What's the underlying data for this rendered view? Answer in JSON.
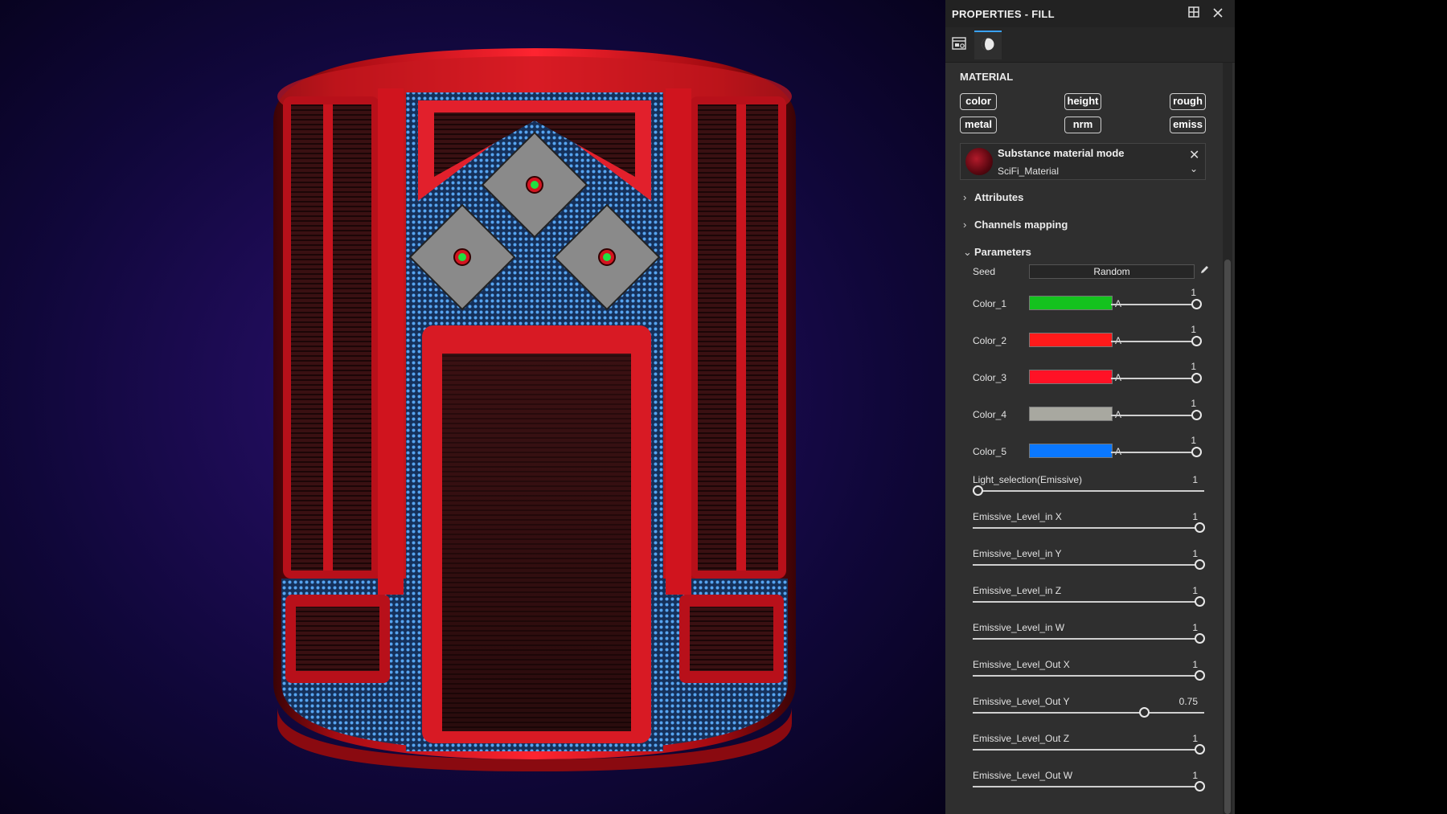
{
  "panel": {
    "title": "PROPERTIES - FILL",
    "dock_icon": "dock-icon",
    "close_icon": "close-icon",
    "tabs": [
      {
        "icon": "layer-settings-icon",
        "active": false
      },
      {
        "icon": "material-sphere-icon",
        "active": true
      }
    ]
  },
  "material": {
    "section_title": "MATERIAL",
    "channels": [
      "color",
      "height",
      "rough",
      "metal",
      "nrm",
      "emiss"
    ]
  },
  "substance": {
    "title": "Substance material mode",
    "material_name": "SciFi_Material",
    "close_glyph": "✕",
    "chevron": "⌄"
  },
  "sections": {
    "attributes": "Attributes",
    "channels_mapping": "Channels mapping",
    "parameters": "Parameters",
    "collapsed_glyph": "›",
    "expanded_glyph": "⌄"
  },
  "seed": {
    "label": "Seed",
    "value": "Random"
  },
  "colors": [
    {
      "label": "Color_1",
      "hex": "#14c21e",
      "alpha_label": "A",
      "value": "1",
      "level": 1
    },
    {
      "label": "Color_2",
      "hex": "#ff1a1a",
      "alpha_label": "A",
      "value": "1",
      "level": 1
    },
    {
      "label": "Color_3",
      "hex": "#ff1226",
      "alpha_label": "A",
      "value": "1",
      "level": 1
    },
    {
      "label": "Color_4",
      "hex": "#a8a8a0",
      "alpha_label": "A",
      "value": "1",
      "level": 1
    },
    {
      "label": "Color_5",
      "hex": "#0a78ff",
      "alpha_label": "A",
      "value": "1",
      "level": 1
    }
  ],
  "sliders": [
    {
      "label": "Light_selection(Emissive)",
      "value": "1",
      "level": 0
    },
    {
      "label": "Emissive_Level_in X",
      "value": "1",
      "level": 1
    },
    {
      "label": "Emissive_Level_in Y",
      "value": "1",
      "level": 1
    },
    {
      "label": "Emissive_Level_in Z",
      "value": "1",
      "level": 1
    },
    {
      "label": "Emissive_Level_in W",
      "value": "1",
      "level": 1
    },
    {
      "label": "Emissive_Level_Out X",
      "value": "1",
      "level": 1
    },
    {
      "label": "Emissive_Level_Out Y",
      "value": "0.75",
      "level": 0.75
    },
    {
      "label": "Emissive_Level_Out Z",
      "value": "1",
      "level": 1
    },
    {
      "label": "Emissive_Level_Out W",
      "value": "1",
      "level": 1
    }
  ]
}
